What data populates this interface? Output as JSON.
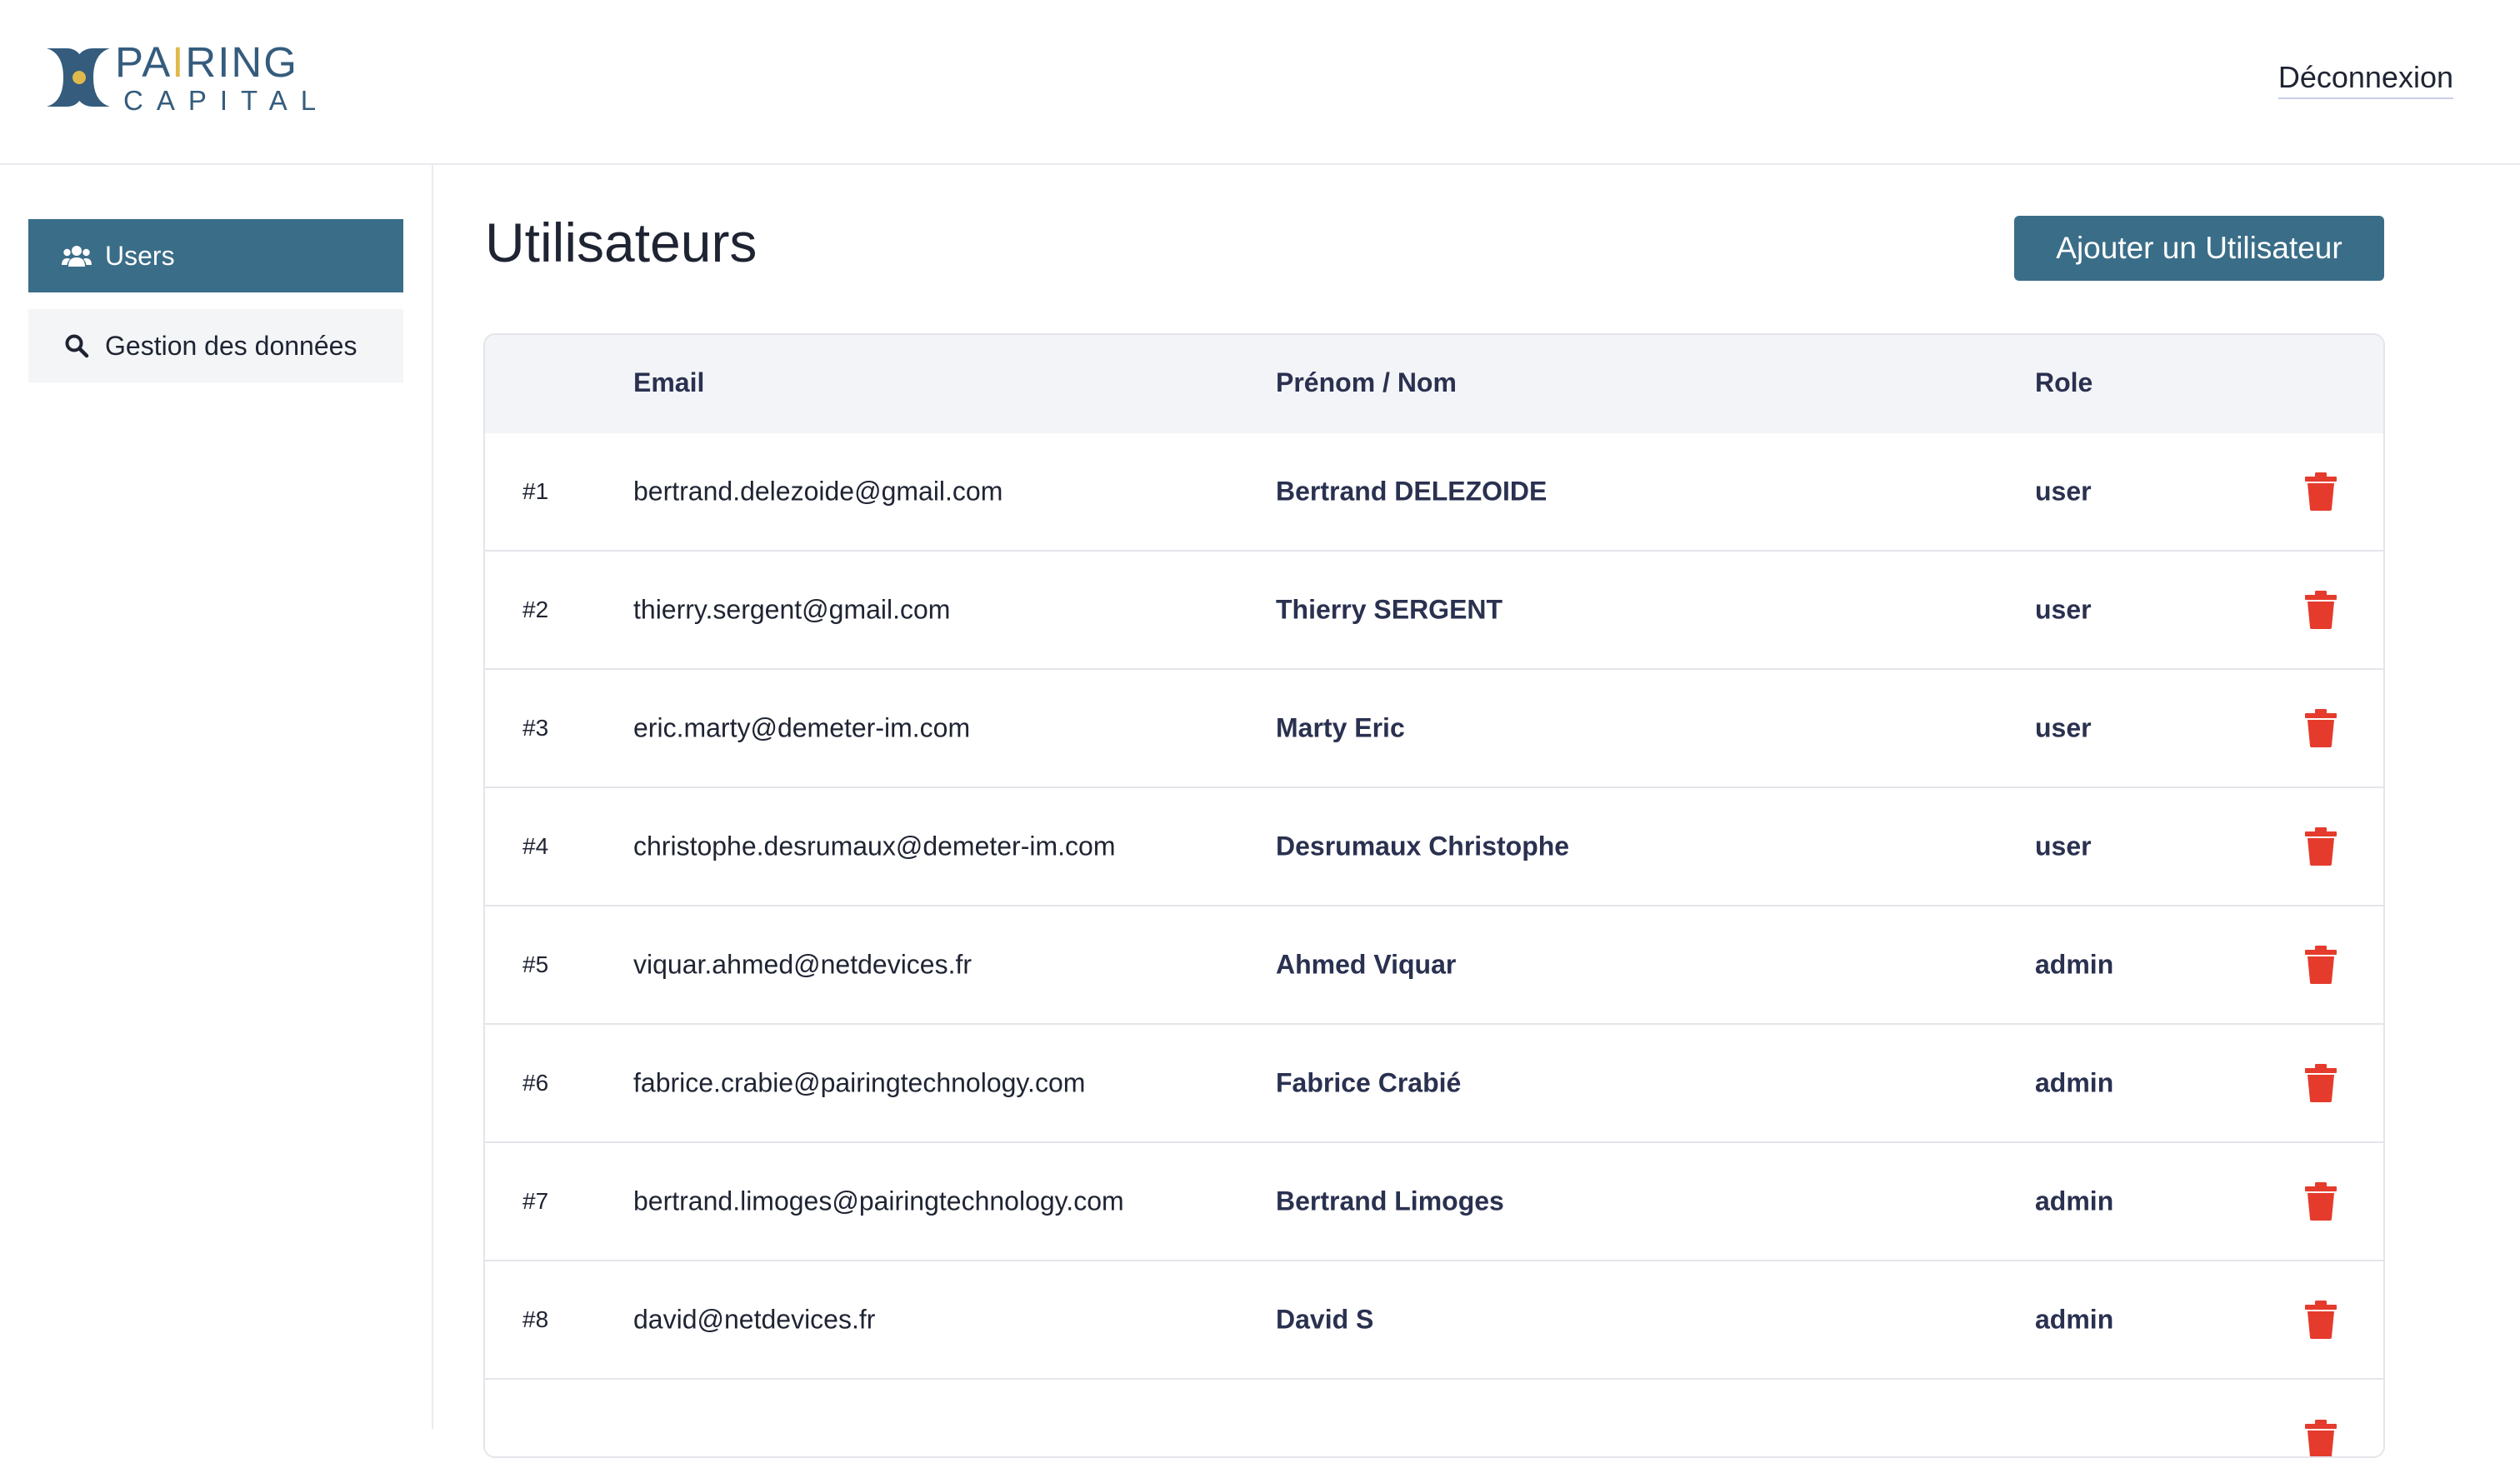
{
  "brand": {
    "line1_a": "PA",
    "line1_accent": "I",
    "line1_b": "RING",
    "line2": "CAPITAL",
    "primary_color": "#355c7d",
    "accent_color": "#e0b94c"
  },
  "header": {
    "logout_label": "Déconnexion"
  },
  "sidebar": {
    "items": [
      {
        "label": "Users",
        "icon": "users-icon",
        "active": true
      },
      {
        "label": "Gestion des données",
        "icon": "search-icon",
        "active": false
      }
    ]
  },
  "page": {
    "title": "Utilisateurs",
    "add_button_label": "Ajouter un Utilisateur"
  },
  "table": {
    "headers": {
      "email": "Email",
      "name": "Prénom / Nom",
      "role": "Role"
    },
    "rows": [
      {
        "id": "#1",
        "email": "bertrand.delezoide@gmail.com",
        "name": "Bertrand DELEZOIDE",
        "role": "user"
      },
      {
        "id": "#2",
        "email": "thierry.sergent@gmail.com",
        "name": "Thierry SERGENT",
        "role": "user"
      },
      {
        "id": "#3",
        "email": "eric.marty@demeter-im.com",
        "name": "Marty Eric",
        "role": "user"
      },
      {
        "id": "#4",
        "email": "christophe.desrumaux@demeter-im.com",
        "name": "Desrumaux Christophe",
        "role": "user"
      },
      {
        "id": "#5",
        "email": "viquar.ahmed@netdevices.fr",
        "name": "Ahmed Viquar",
        "role": "admin"
      },
      {
        "id": "#6",
        "email": "fabrice.crabie@pairingtechnology.com",
        "name": "Fabrice Crabié",
        "role": "admin"
      },
      {
        "id": "#7",
        "email": "bertrand.limoges@pairingtechnology.com",
        "name": "Bertrand Limoges",
        "role": "admin"
      },
      {
        "id": "#8",
        "email": "david@netdevices.fr",
        "name": "David S",
        "role": "admin"
      }
    ]
  },
  "colors": {
    "primary": "#3a6d88",
    "delete": "#e53b2c",
    "header_bg": "#f3f4f7"
  }
}
